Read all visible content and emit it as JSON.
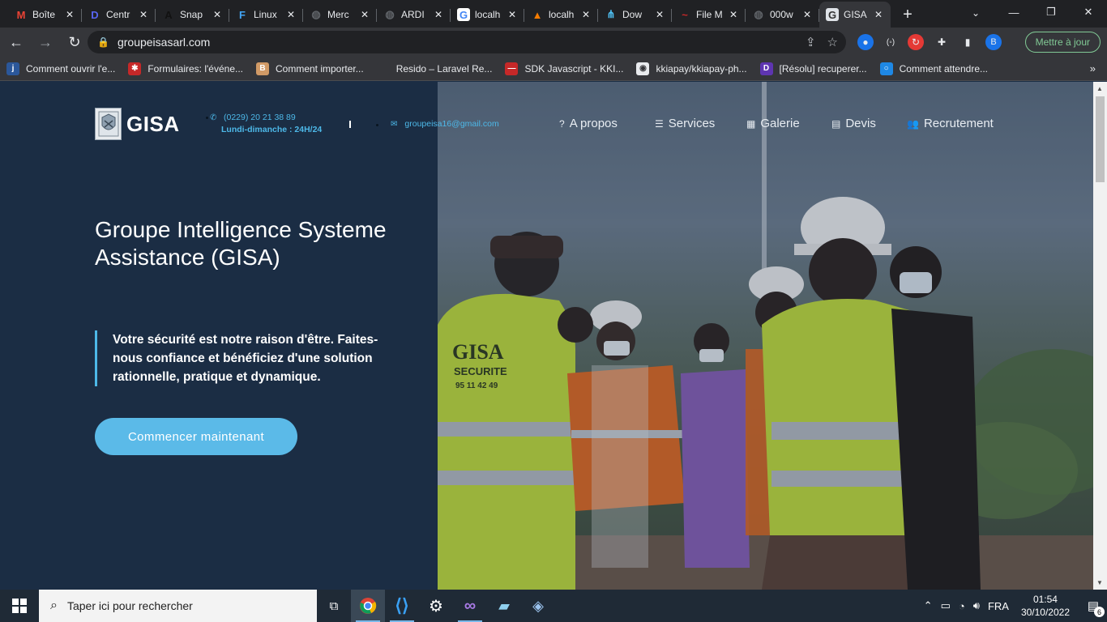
{
  "tabs": [
    {
      "title": "Boîte",
      "favicon": "gmail-icon",
      "color": "#ea4335",
      "glyph": "M"
    },
    {
      "title": "Centr",
      "favicon": "discord-like-icon",
      "color": "#5865f2",
      "glyph": "D"
    },
    {
      "title": "Snap",
      "favicon": "angular-icon",
      "color": "#111111",
      "glyph": "A"
    },
    {
      "title": "Linux",
      "favicon": "flutter-icon",
      "color": "#42a5f5",
      "glyph": "F"
    },
    {
      "title": "Merc",
      "favicon": "globe-icon",
      "color": "#5f6368",
      "glyph": "◍"
    },
    {
      "title": "ARDI",
      "favicon": "globe-icon",
      "color": "#5f6368",
      "glyph": "◍"
    },
    {
      "title": "localh",
      "favicon": "google-icon",
      "color": "#ffffff",
      "glyph": "G"
    },
    {
      "title": "localh",
      "favicon": "xampp-icon",
      "color": "#f57c00",
      "glyph": "▲"
    },
    {
      "title": "Dow",
      "favicon": "share-icon",
      "color": "#4fc3f7",
      "glyph": "⋔"
    },
    {
      "title": "File M",
      "favicon": "fm-icon",
      "color": "#c62828",
      "glyph": "~"
    },
    {
      "title": "000w",
      "favicon": "globe-icon",
      "color": "#5f6368",
      "glyph": "◍"
    },
    {
      "title": "GISA",
      "favicon": "gisa-icon",
      "color": "#dfe3e8",
      "glyph": "G",
      "active": true
    }
  ],
  "omnibox": {
    "url": "groupeisasarl.com"
  },
  "update_button": "Mettre à jour",
  "profile_letter": "B",
  "bookmarks": [
    {
      "label": "Comment ouvrir l'e...",
      "color": "#2b579a",
      "glyph": "j"
    },
    {
      "label": "Formulaires: l'événe...",
      "color": "#c62828",
      "glyph": "✱"
    },
    {
      "label": "Comment importer...",
      "color": "#d19a66",
      "glyph": "B"
    },
    {
      "label": "Resido – Laravel Re...",
      "color": "#35363a",
      "glyph": ""
    },
    {
      "label": "SDK Javascript - KKI...",
      "color": "#c62828",
      "glyph": "—"
    },
    {
      "label": "kkiapay/kkiapay-ph...",
      "color": "#e8eaed",
      "glyph": "◉"
    },
    {
      "label": "[Résolu] recuperer...",
      "color": "#5e35b1",
      "glyph": "D"
    },
    {
      "label": "Comment attendre...",
      "color": "#1e88e5",
      "glyph": "○"
    }
  ],
  "site": {
    "brand": "GISA",
    "phone": "(0229) 20 21 38 89",
    "hours": "Lundi-dimanche : 24H/24",
    "email": "groupeisa16@gmail.com",
    "nav": [
      {
        "label": "A propos",
        "icon": "question-circle-icon",
        "glyph": "?"
      },
      {
        "label": "Services",
        "icon": "list-icon",
        "glyph": "☰"
      },
      {
        "label": "Galerie",
        "icon": "grid-icon",
        "glyph": "▦"
      },
      {
        "label": "Devis",
        "icon": "document-icon",
        "glyph": "▤"
      },
      {
        "label": "Recrutement",
        "icon": "users-icon",
        "glyph": "👥"
      }
    ],
    "hero_title": "Groupe Intelligence Systeme Assistance (GISA)",
    "hero_quote": "Votre sécurité est notre raison d'être. Faites-nous confiance et bénéficiez d'une solution rationnelle, pratique et dynamique.",
    "cta": "Commencer maintenant",
    "vest_text_1": "GISA",
    "vest_text_2": "SECURITE",
    "vest_text_3": "95 11 42 49"
  },
  "taskbar": {
    "search_placeholder": "Taper ici pour rechercher",
    "language": "FRA",
    "time": "01:54",
    "date": "30/10/2022",
    "notification_count": "6"
  },
  "colors": {
    "accent": "#4db8e8",
    "page_bg": "#1b2d44",
    "cta_bg": "#5bbae8"
  }
}
